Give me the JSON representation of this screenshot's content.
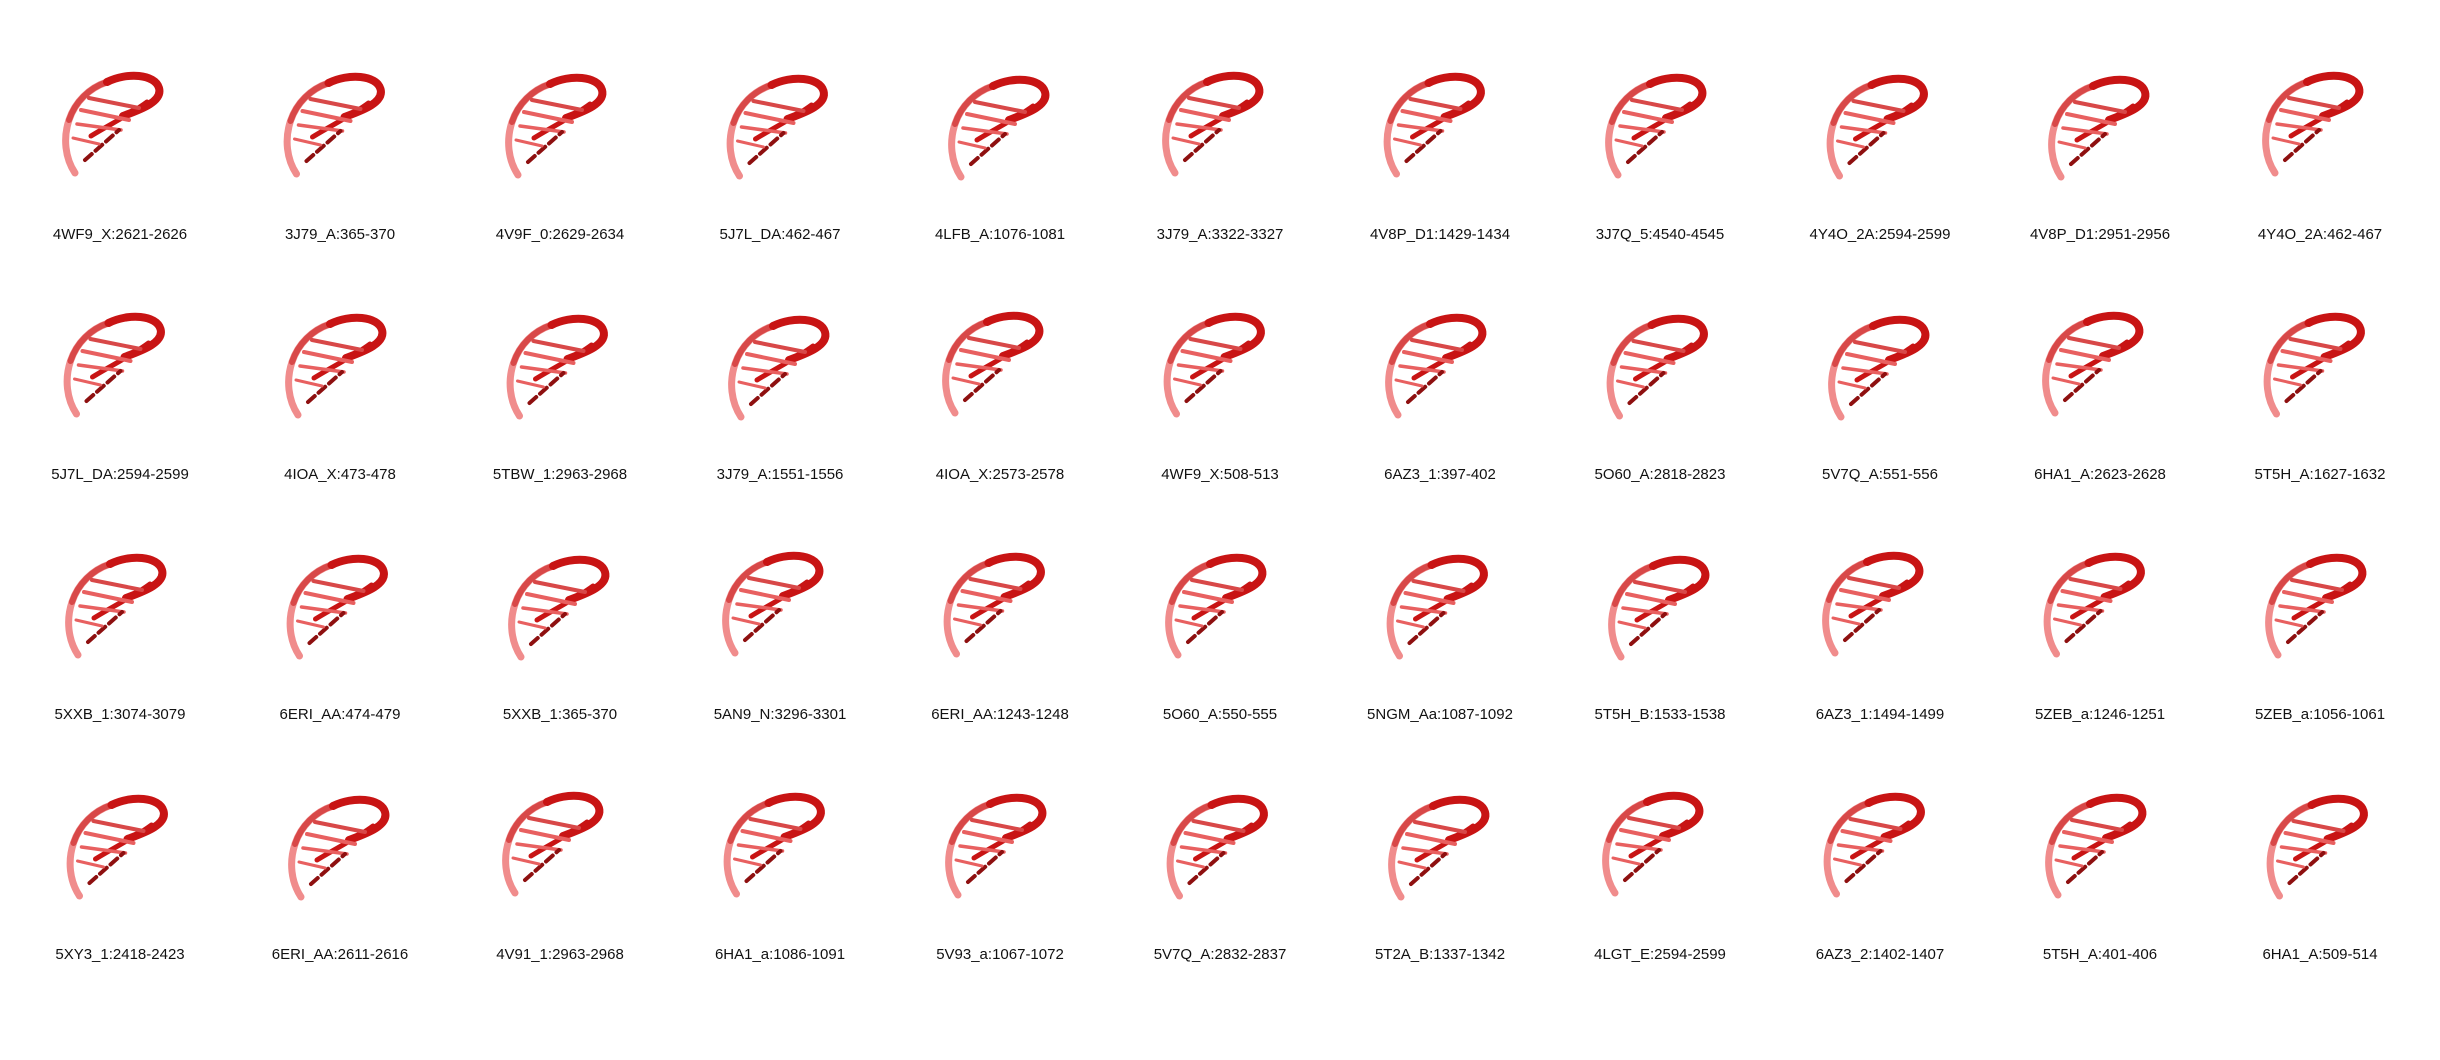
{
  "figure": {
    "labels": [
      [
        "4WF9_X:2621-2626",
        "3J79_A:365-370",
        "4V9F_0:2629-2634",
        "5J7L_DA:462-467",
        "4LFB_A:1076-1081",
        "3J79_A:3322-3327",
        "4V8P_D1:1429-1434",
        "3J7Q_5:4540-4545",
        "4Y4O_2A:2594-2599",
        "4V8P_D1:2951-2956",
        "4Y4O_2A:462-467"
      ],
      [
        "5J7L_DA:2594-2599",
        "4IOA_X:473-478",
        "5TBW_1:2963-2968",
        "3J79_A:1551-1556",
        "4IOA_X:2573-2578",
        "4WF9_X:508-513",
        "6AZ3_1:397-402",
        "5O60_A:2818-2823",
        "5V7Q_A:551-556",
        "6HA1_A:2623-2628",
        "5T5H_A:1627-1632"
      ],
      [
        "5XXB_1:3074-3079",
        "6ERI_AA:474-479",
        "5XXB_1:365-370",
        "5AN9_N:3296-3301",
        "6ERI_AA:1243-1248",
        "5O60_A:550-555",
        "5NGM_Aa:1087-1092",
        "5T5H_B:1533-1538",
        "6AZ3_1:1494-1499",
        "5ZEB_a:1246-1251",
        "5ZEB_a:1056-1061"
      ],
      [
        "5XY3_1:2418-2423",
        "6ERI_AA:2611-2616",
        "4V91_1:2963-2968",
        "6HA1_a:1086-1091",
        "5V93_a:1067-1072",
        "5V7Q_A:2832-2837",
        "5T2A_B:1337-1342",
        "4LGT_E:2594-2599",
        "6AZ3_2:1402-1407",
        "5T5H_A:401-406",
        "6HA1_A:509-514"
      ]
    ],
    "colors": {
      "backbone_light": "#f08c8c",
      "backbone_mid": "#d84848",
      "backbone_dark": "#c81414",
      "base_dark": "#8e1010",
      "base_light": "#e86060"
    }
  }
}
